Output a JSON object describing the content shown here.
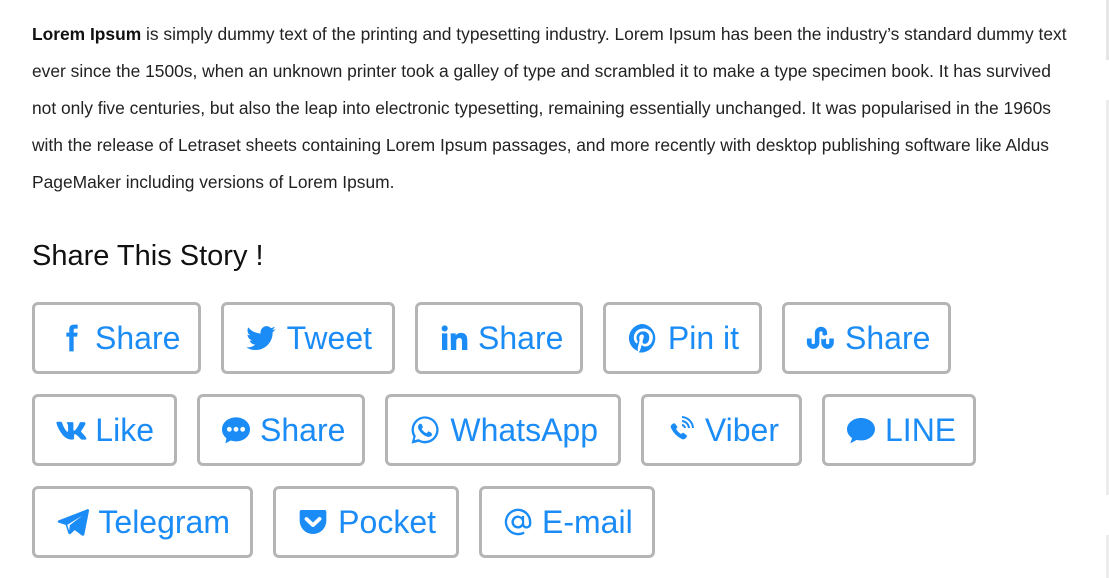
{
  "article": {
    "lead_bold": "Lorem Ipsum",
    "body": " is simply dummy text of the printing and typesetting industry. Lorem Ipsum has been the industry’s standard dummy text ever since the 1500s, when an unknown printer took a galley of type and scrambled it to make a type specimen book. It has survived not only five centuries, but also the leap into electronic typesetting, remaining essentially unchanged. It was popularised in the 1960s with the release of Letraset sheets containing Lorem Ipsum passages, and more recently with desktop publishing software like Aldus PageMaker including versions of Lorem Ipsum."
  },
  "share": {
    "title": "Share This Story !",
    "accent_color": "#1b8cf5",
    "border_color": "#b5b5b5",
    "buttons": [
      {
        "network": "facebook",
        "icon": "facebook-icon",
        "label": "Share"
      },
      {
        "network": "twitter",
        "icon": "twitter-icon",
        "label": "Tweet"
      },
      {
        "network": "linkedin",
        "icon": "linkedin-icon",
        "label": "Share"
      },
      {
        "network": "pinterest",
        "icon": "pinterest-icon",
        "label": "Pin it"
      },
      {
        "network": "stumbleupon",
        "icon": "stumbleupon-icon",
        "label": "Share"
      },
      {
        "network": "vk",
        "icon": "vk-icon",
        "label": "Like"
      },
      {
        "network": "messenger",
        "icon": "messenger-icon",
        "label": "Share"
      },
      {
        "network": "whatsapp",
        "icon": "whatsapp-icon",
        "label": "WhatsApp"
      },
      {
        "network": "viber",
        "icon": "viber-icon",
        "label": "Viber"
      },
      {
        "network": "line",
        "icon": "line-icon",
        "label": "LINE"
      },
      {
        "network": "telegram",
        "icon": "telegram-icon",
        "label": "Telegram"
      },
      {
        "network": "pocket",
        "icon": "pocket-icon",
        "label": "Pocket"
      },
      {
        "network": "email",
        "icon": "email-icon",
        "label": "E-mail"
      }
    ]
  }
}
